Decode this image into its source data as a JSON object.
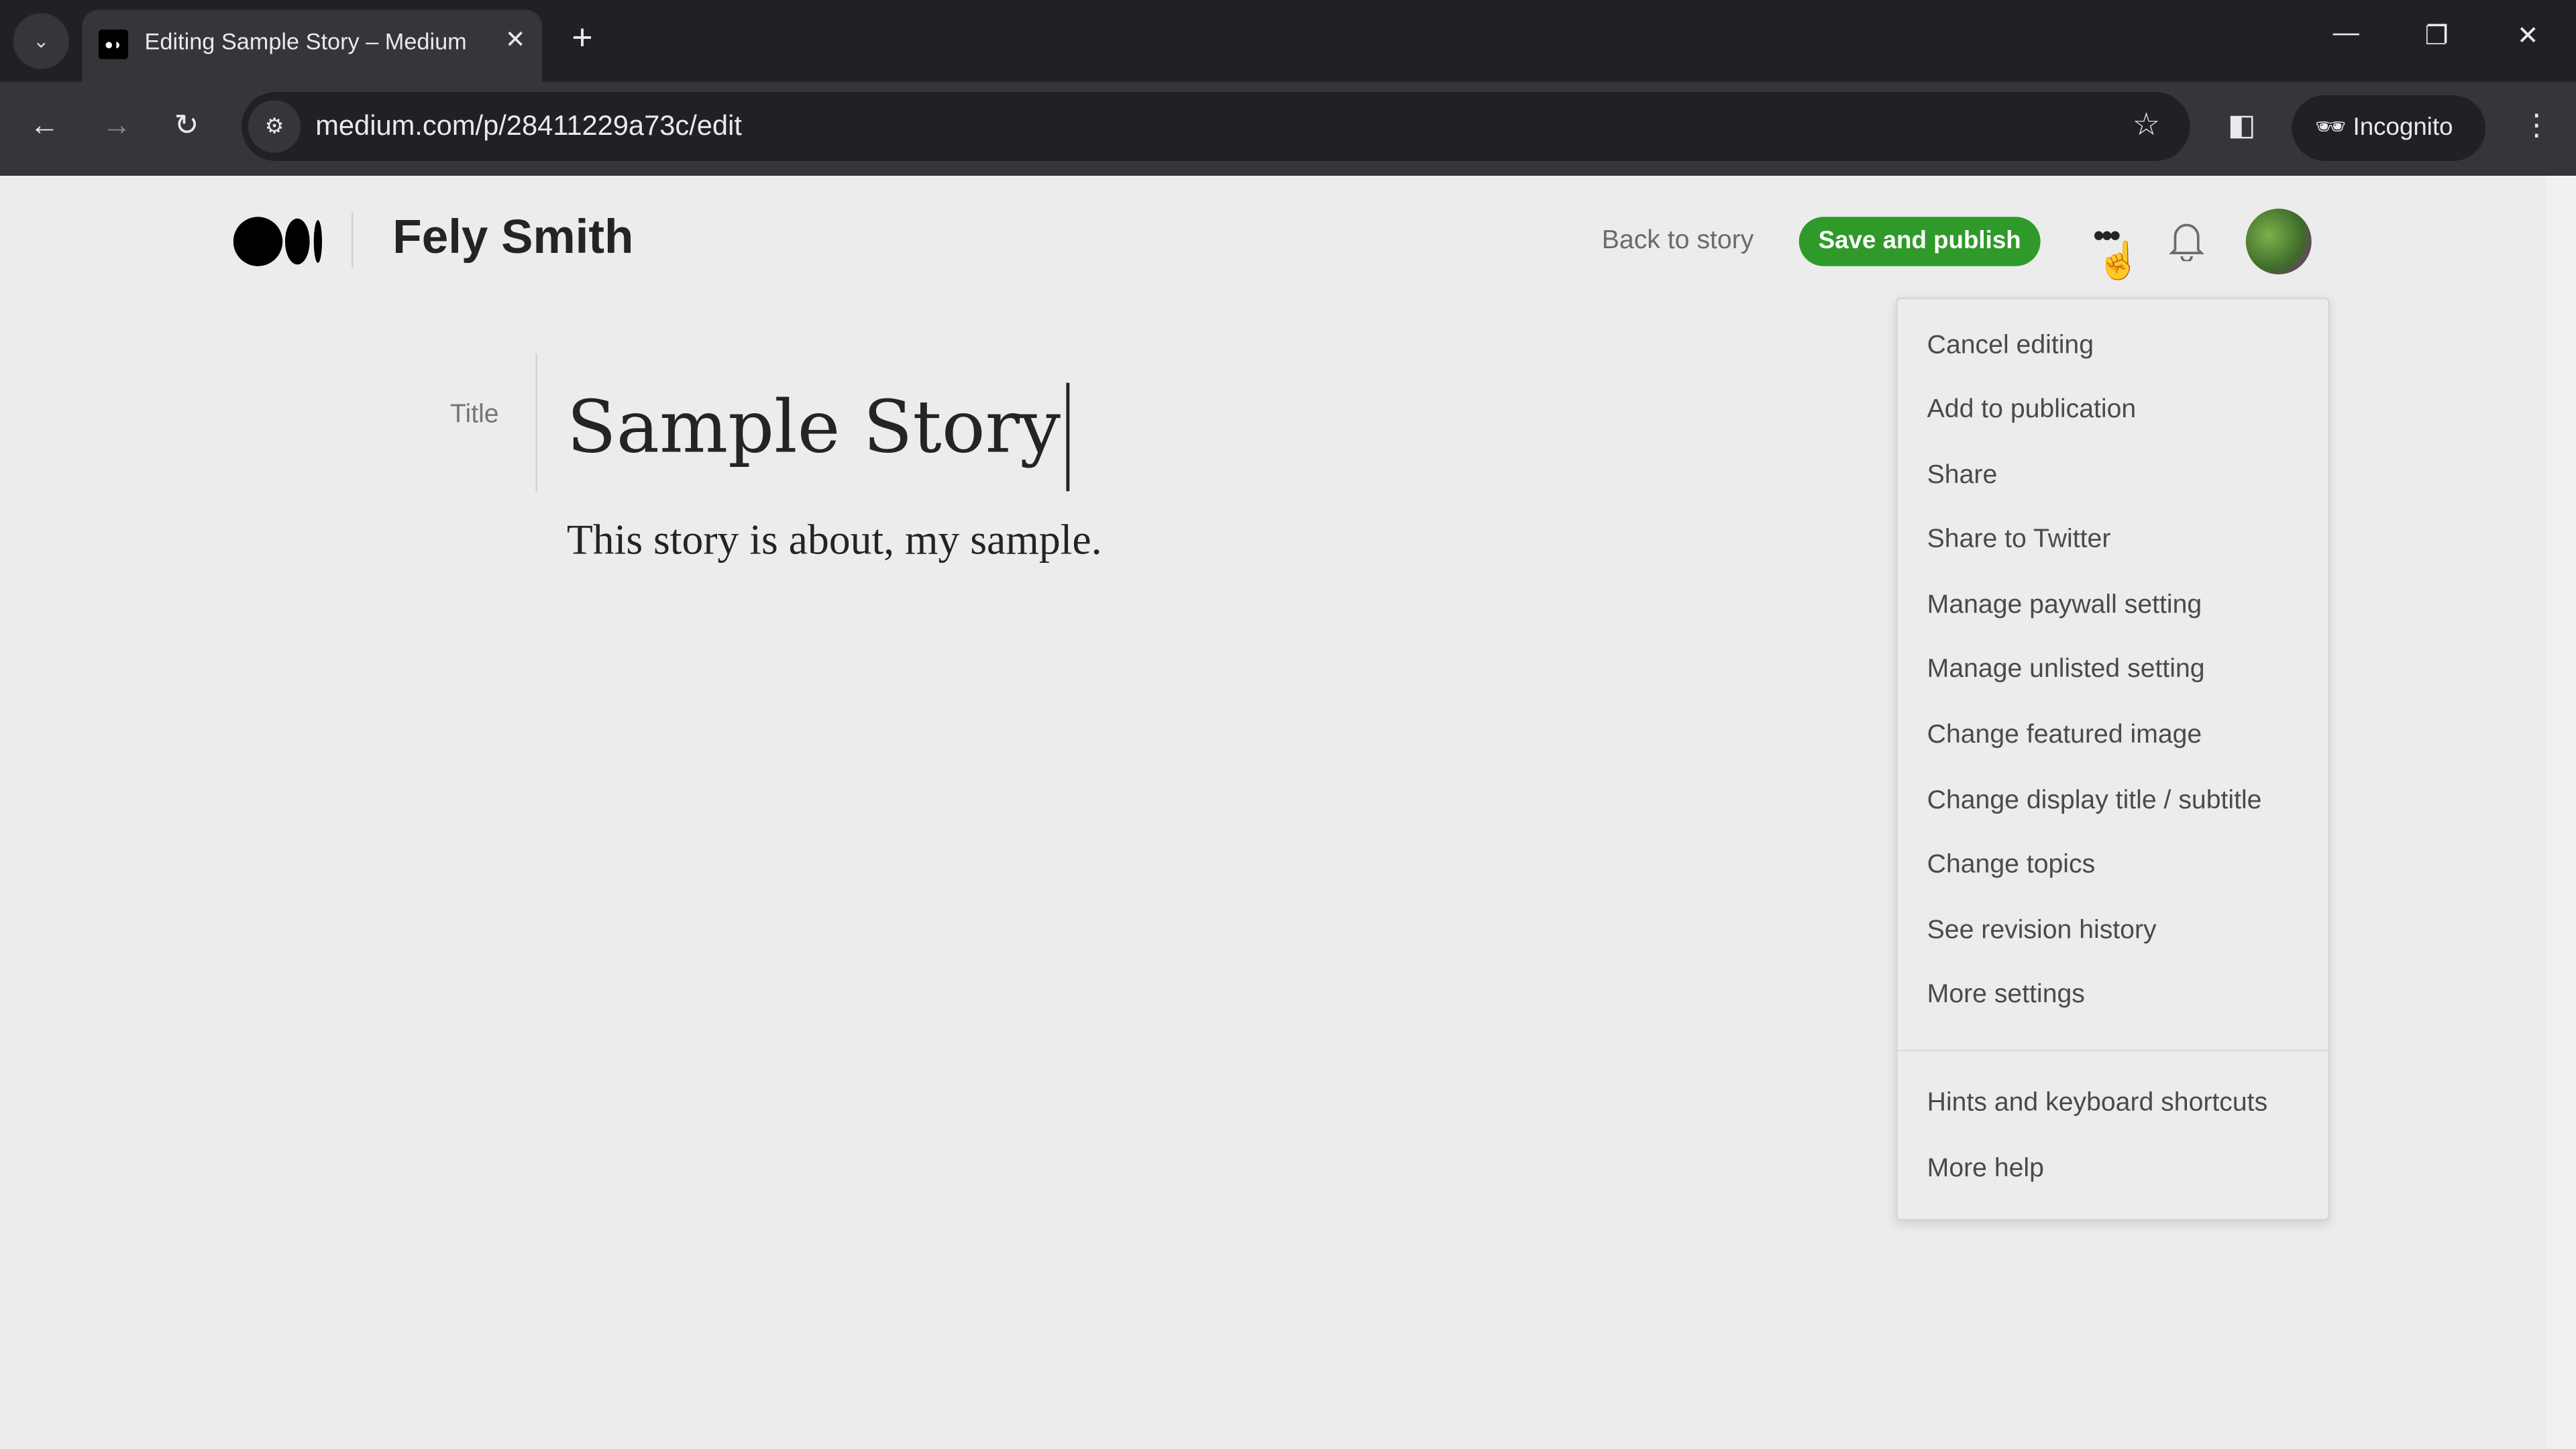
{
  "browser": {
    "tab_title": "Editing Sample Story – Medium",
    "url": "medium.com/p/28411229a73c/edit",
    "incognito_label": "Incognito"
  },
  "header": {
    "author": "Fely Smith",
    "back_label": "Back to story",
    "publish_label": "Save and publish",
    "accent": "#2f9a2a"
  },
  "editor": {
    "title_label": "Title",
    "title": "Sample Story",
    "body": "This story is about, my sample."
  },
  "menu": {
    "items": [
      "Cancel editing",
      "Add to publication",
      "Share",
      "Share to Twitter",
      "Manage paywall setting",
      "Manage unlisted setting",
      "Change featured image",
      "Change display title / subtitle",
      "Change topics",
      "See revision history",
      "More settings"
    ],
    "help_items": [
      "Hints and keyboard shortcuts",
      "More help"
    ]
  }
}
